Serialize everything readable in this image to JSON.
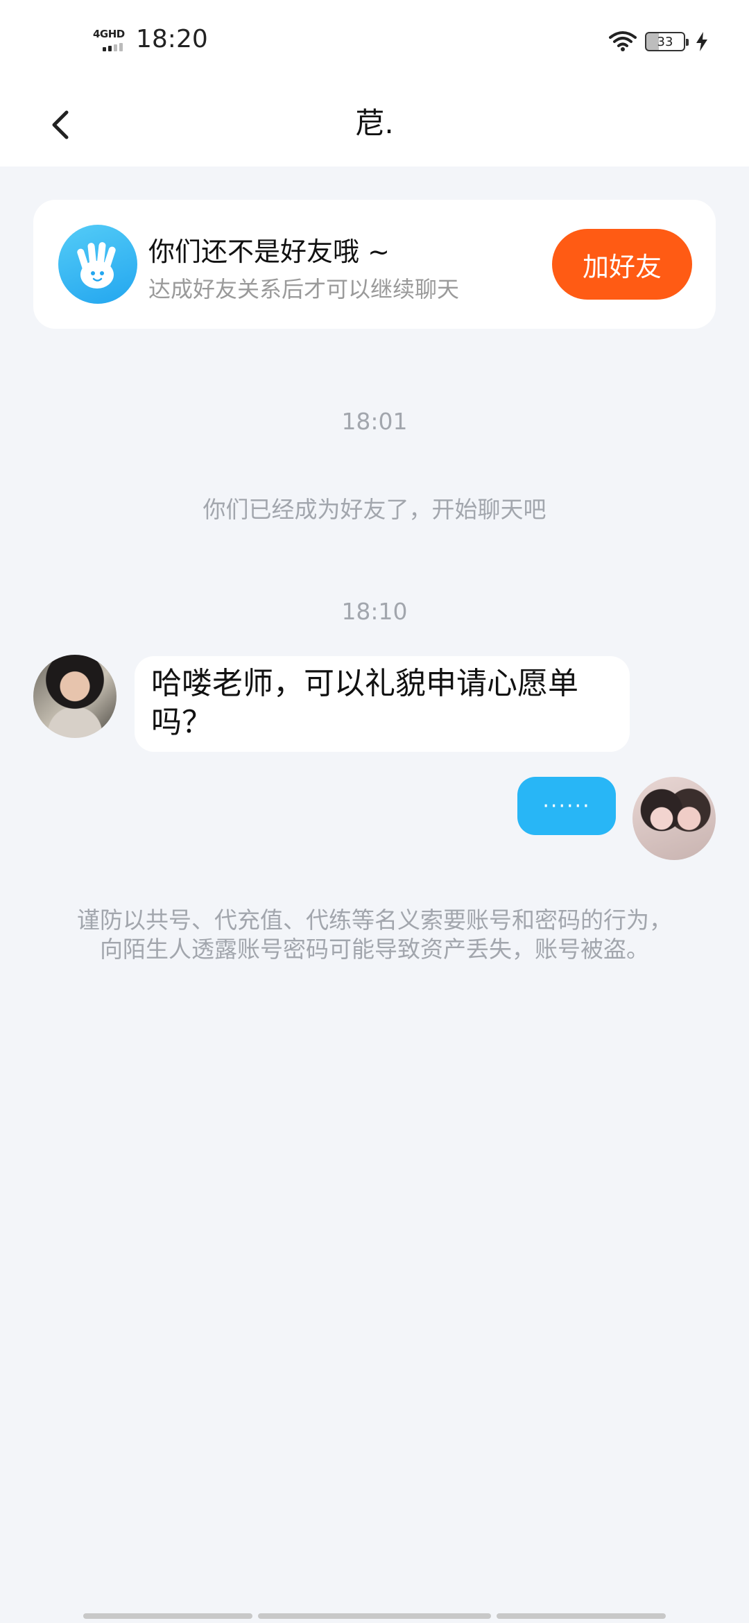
{
  "status_bar": {
    "network": "4GHD",
    "time": "18:20",
    "battery_level": "33"
  },
  "nav": {
    "title": "苨."
  },
  "friend_card": {
    "title": "你们还不是好友哦 ~",
    "subtitle": "达成好友关系后才可以继续聊天",
    "button_label": "加好友"
  },
  "chat": {
    "timestamp_1": "18:01",
    "system_note": "你们已经成为好友了，开始聊天吧",
    "timestamp_2": "18:10",
    "received_message": "哈喽老师，可以礼貌申请心愿单吗？",
    "sent_message": "······",
    "warning": "谨防以共号、代充值、代练等名义索要账号和密码的行为，向陌生人透露账号密码可能导致资产丢失，账号被盗。"
  },
  "colors": {
    "accent_orange": "#ff5b14",
    "sent_bubble_blue": "#28b6f6",
    "background": "#f3f5f9"
  }
}
